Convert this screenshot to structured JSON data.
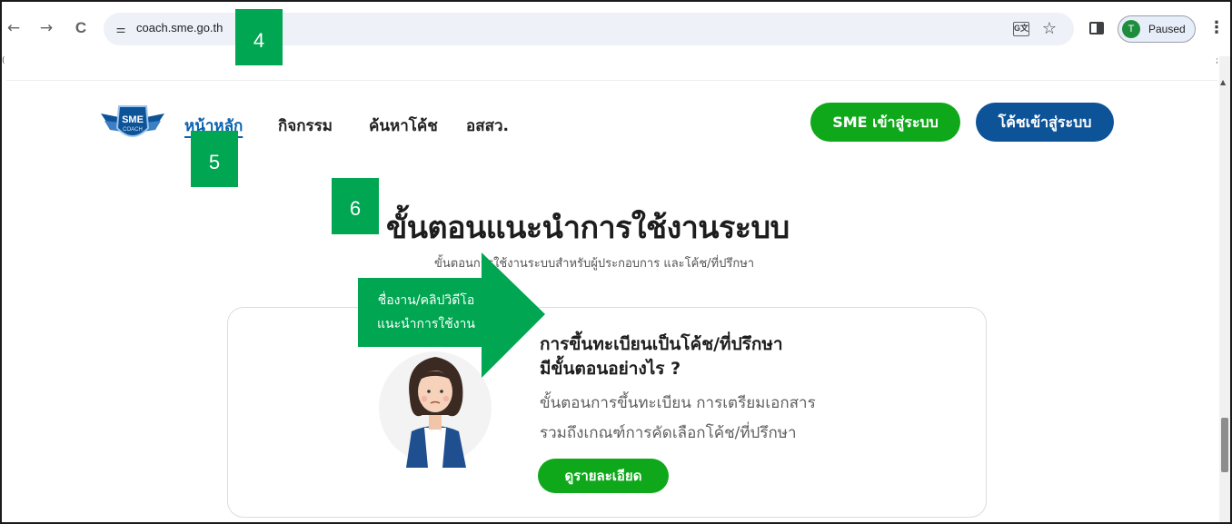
{
  "browser": {
    "url": "coach.sme.go.th",
    "profile_initial": "T",
    "profile_status": "Paused",
    "icons": [
      "back-icon",
      "forward-icon",
      "reload-icon",
      "site-info-icon",
      "translate-icon",
      "bookmark-star-icon",
      "side-panel-icon",
      "more-menu-icon"
    ],
    "glyphs": {
      "back": "←",
      "forward": "→",
      "reload": "C",
      "site_info": "⚌",
      "translate": "G文",
      "star": "☆",
      "menu": "⋮"
    }
  },
  "site": {
    "logo_text": "SME",
    "logo_subtext": "COACH",
    "nav": [
      {
        "label": "หน้าหลัก",
        "active": true
      },
      {
        "label": "กิจกรรม",
        "active": false
      },
      {
        "label": "ค้นหาโค้ช",
        "active": false
      },
      {
        "label": "อสสว.",
        "active": false
      }
    ],
    "login_sme": "SME เข้าสู่ระบบ",
    "login_coach": "โค้ชเข้าสู่ระบบ"
  },
  "content": {
    "heading": "ขั้นตอนแนะนำการใช้งานระบบ",
    "subheading": "ขั้นตอนการใช้งานระบบสำหรับผู้ประกอบการ และโค้ช/ที่ปรึกษา",
    "card": {
      "title_line1": "การขึ้นทะเบียนเป็นโค้ช/ที่ปรึกษา",
      "title_line2": "มีขั้นตอนอย่างไร ?",
      "desc_line1": "ขั้นตอนการขึ้นทะเบียน การเตรียมเอกสาร",
      "desc_line2": "รวมถึงเกณฑ์การคัดเลือกโค้ช/ที่ปรึกษา",
      "button": "ดูรายละเอียด"
    }
  },
  "annotations": {
    "marker_4": "4",
    "marker_5": "5",
    "marker_6": "6",
    "arrow_line1": "ชื่องาน/คลิปวิดีโอ",
    "arrow_line2": "แนะนำการใช้งาน"
  },
  "colors": {
    "sme_green": "#10a81b",
    "coach_blue": "#0d5398",
    "annotation_green": "#00a651",
    "nav_active": "#0a62b0"
  }
}
